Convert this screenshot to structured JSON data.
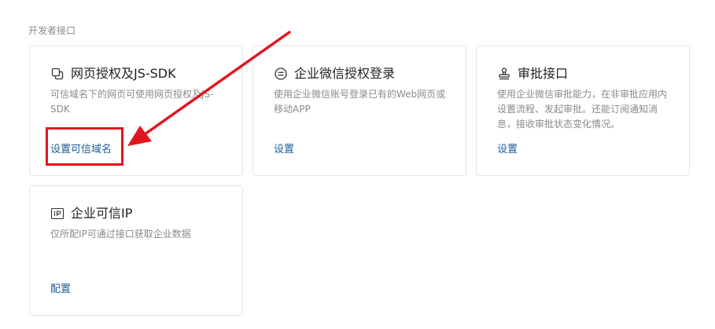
{
  "section": {
    "title": "开发者接口"
  },
  "cards": [
    {
      "icon": "copy-pages-icon",
      "title": "网页授权及JS-SDK",
      "desc_lines": [
        "可信域名下的网页可使用网页授权及JS-",
        "SDK"
      ],
      "link": "设置可信域名"
    },
    {
      "icon": "equals-circle-icon",
      "title": "企业微信授权登录",
      "desc_lines": [
        "使用企业微信账号登录已有的Web网页或",
        "移动APP"
      ],
      "link": "设置"
    },
    {
      "icon": "stamp-icon",
      "title": "审批接口",
      "desc_lines": [
        "使用企业微信审批能力，在非审批应用内",
        "设置流程、发起审批。还能订阅通知消",
        "息，接收审批状态变化情况。"
      ],
      "link": "设置"
    },
    {
      "icon": "ip-badge-icon",
      "title": "企业可信IP",
      "desc_lines": [
        "仅所配IP可通过接口获取企业数据"
      ],
      "link": "配置"
    }
  ],
  "annotation": {
    "color": "#e0161f"
  },
  "colors": {
    "link": "#1f5a9a",
    "title": "#222222",
    "desc": "#8a8a8a",
    "border": "#e6e6e6"
  }
}
